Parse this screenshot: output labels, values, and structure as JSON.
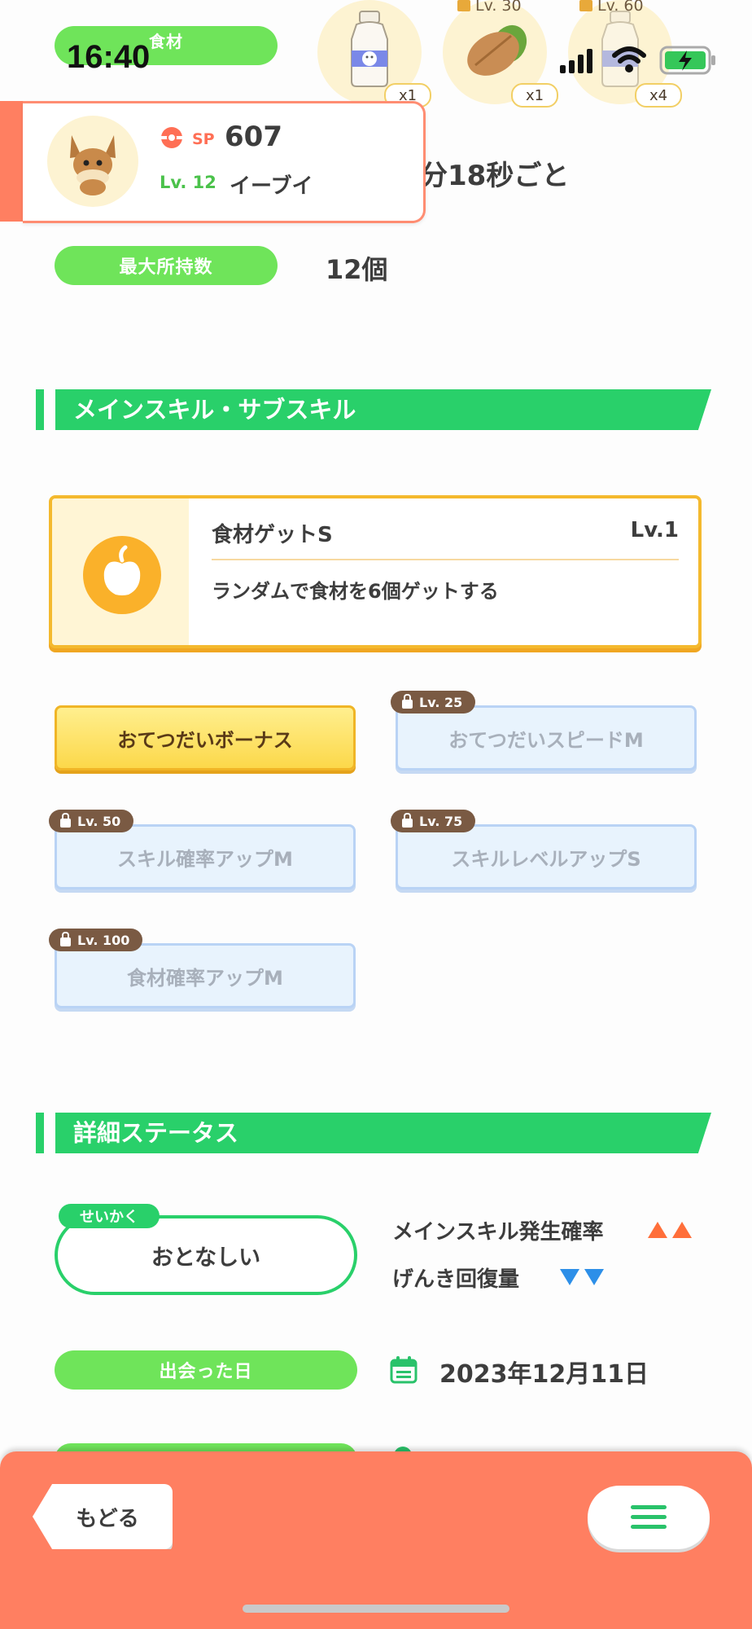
{
  "status_bar": {
    "time": "16:40"
  },
  "ingredients": {
    "label": "食材",
    "items": [
      {
        "name": "milk-icon",
        "count": "x1",
        "locked": false,
        "level": ""
      },
      {
        "name": "cacao-icon",
        "count": "x1",
        "locked": true,
        "level": "Lv. 30"
      },
      {
        "name": "milk-icon",
        "count": "x4",
        "locked": true,
        "level": "Lv. 60"
      }
    ],
    "interval_text": "分18秒ごと"
  },
  "pokemon_card": {
    "sp_label": "SP",
    "sp_value": "607",
    "level": "Lv. 12",
    "name": "イーブイ"
  },
  "max_carry": {
    "label": "最大所持数",
    "value": "12個"
  },
  "skills_section": {
    "title": "メインスキル・サブスキル",
    "main_skill": {
      "name": "食材ゲットS",
      "level": "Lv.1",
      "description": "ランダムで食材を6個ゲットする"
    },
    "sub_skills": [
      {
        "label": "おてつだいボーナス",
        "lock": ""
      },
      {
        "label": "おてつだいスピードM",
        "lock": "Lv. 25"
      },
      {
        "label": "スキル確率アップM",
        "lock": "Lv. 50"
      },
      {
        "label": "スキルレベルアップS",
        "lock": "Lv. 75"
      },
      {
        "label": "食材確率アップM",
        "lock": "Lv. 100"
      }
    ]
  },
  "details_section": {
    "title": "詳細ステータス",
    "nature_tag": "せいかく",
    "nature_value": "おとなしい",
    "nature_up": "メインスキル発生確率",
    "nature_down": "げんき回復量",
    "met_date_label": "出会った日",
    "met_date_value": "2023年12月11日"
  },
  "bottom_bar": {
    "back_label": "もどる"
  },
  "colors": {
    "accent_green": "#29d06a",
    "pill_green": "#6fe45a",
    "bottom_coral": "#ff7f61",
    "gold": "#f4b92e"
  }
}
